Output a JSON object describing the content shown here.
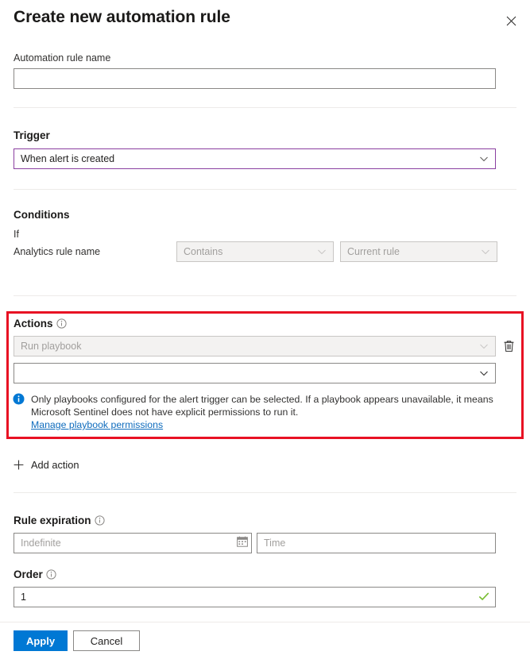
{
  "header": {
    "title": "Create new automation rule",
    "close_icon": "close-icon"
  },
  "name_section": {
    "label": "Automation rule name",
    "value": "",
    "placeholder": ""
  },
  "trigger_section": {
    "label": "Trigger",
    "selected": "When alert is created",
    "accent_color": "#8a3fa0"
  },
  "conditions_section": {
    "label": "Conditions",
    "if_label": "If",
    "property_label": "Analytics rule name",
    "operator": "Contains",
    "value": "Current rule"
  },
  "actions_section": {
    "label": "Actions",
    "info_icon": "info-circle-icon",
    "action_type": "Run playbook",
    "playbook_value": "",
    "delete_icon": "trash-icon",
    "note_line1": "Only playbooks configured for the alert trigger can be selected. If a playbook appears unavailable, it means",
    "note_line2": "Microsoft Sentinel does not have explicit permissions to run it.",
    "note_link": "Manage playbook permissions",
    "highlight_color": "#e81123"
  },
  "add_action": {
    "label": "Add action",
    "icon": "plus-icon"
  },
  "rule_expiration": {
    "label": "Rule expiration",
    "info_icon": "info-circle-icon",
    "date_placeholder": "Indefinite",
    "date_value": "",
    "calendar_icon": "calendar-icon",
    "time_placeholder": "Time",
    "time_value": ""
  },
  "order": {
    "label": "Order",
    "info_icon": "info-circle-icon",
    "value": "1",
    "valid_icon": "checkmark-icon",
    "valid_color": "#76bc2d"
  },
  "footer": {
    "apply_label": "Apply",
    "cancel_label": "Cancel",
    "primary_color": "#0078d4"
  }
}
